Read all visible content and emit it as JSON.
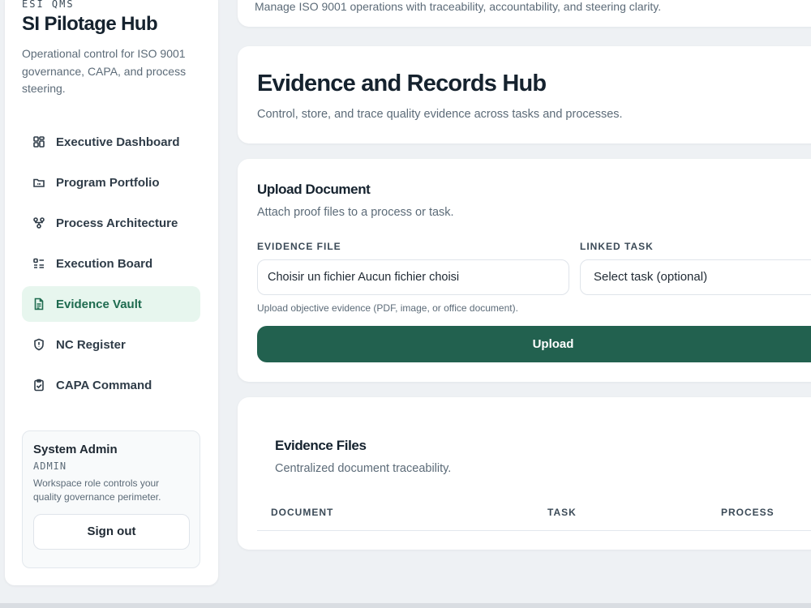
{
  "sidebar": {
    "kicker": "ESI QMS",
    "title": "SI Pilotage Hub",
    "description": "Operational control for ISO 9001 governance, CAPA, and process steering.",
    "items": [
      {
        "label": "Executive Dashboard",
        "icon": "dashboard-icon"
      },
      {
        "label": "Program Portfolio",
        "icon": "folder-icon"
      },
      {
        "label": "Process Architecture",
        "icon": "process-icon"
      },
      {
        "label": "Execution Board",
        "icon": "list-icon"
      },
      {
        "label": "Evidence Vault",
        "icon": "document-icon",
        "active": true
      },
      {
        "label": "NC Register",
        "icon": "shield-icon"
      },
      {
        "label": "CAPA Command",
        "icon": "clipboard-icon"
      }
    ],
    "user": {
      "name": "System Admin",
      "role": "ADMIN",
      "note": "Workspace role controls your quality governance perimeter.",
      "signout_label": "Sign out"
    }
  },
  "top_banner": {
    "text": "Manage ISO 9001 operations with traceability, accountability, and steering clarity."
  },
  "header": {
    "title": "Evidence and Records Hub",
    "subtitle": "Control, store, and trace quality evidence across tasks and processes."
  },
  "upload": {
    "title": "Upload Document",
    "subtitle": "Attach proof files to a process or task.",
    "file_label": "EVIDENCE FILE",
    "file_value": "Choisir un fichier Aucun fichier choisi",
    "task_label": "LINKED TASK",
    "task_value": "Select task (optional)",
    "hint": "Upload objective evidence (PDF, image, or office document).",
    "button_label": "Upload"
  },
  "files": {
    "title": "Evidence Files",
    "subtitle": "Centralized document traceability.",
    "columns": [
      "DOCUMENT",
      "TASK",
      "PROCESS"
    ]
  },
  "colors": {
    "accent": "#22614f",
    "active_bg": "#e7f6ee",
    "active_text": "#1e6b4f"
  }
}
